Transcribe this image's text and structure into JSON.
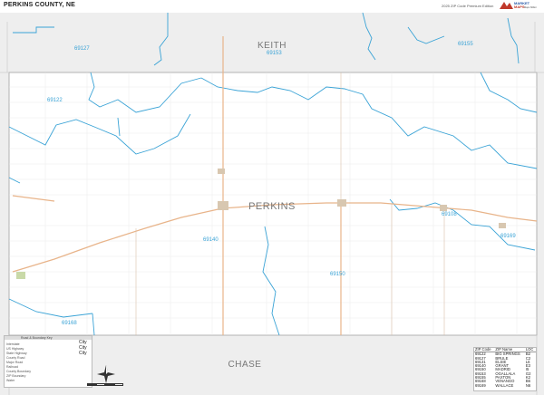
{
  "header": {
    "title": "PERKINS COUNTY, NE",
    "edition": "2025 ZIP Code Premium Edition",
    "brand_line1": "MARKET",
    "brand_line2": "MAPS",
    "brand_line3": "Maps Millions"
  },
  "counties": {
    "main": "PERKINS",
    "north": "KEITH",
    "south": "CHASE"
  },
  "zip_labels": [
    "69127",
    "69153",
    "69155",
    "69122",
    "69108",
    "69169",
    "69140",
    "69150",
    "69168"
  ],
  "legend": {
    "title": "Road & Boundary Key",
    "city_label": "City",
    "city_line2": "City",
    "city_line3": "City",
    "rows": [
      "Interstate",
      "US Highway",
      "State Highway",
      "County Road",
      "Major Road",
      "Railroad",
      "County Boundary",
      "ZIP Boundary",
      "Water"
    ]
  },
  "zip_table": {
    "headers": [
      "ZIP Code",
      "ZIP Name",
      "LOC"
    ],
    "rows": [
      [
        "69122",
        "BIG SPRINGS",
        "B2"
      ],
      [
        "69127",
        "BRULE",
        "C2"
      ],
      [
        "69131",
        "ELSIE",
        "L6"
      ],
      [
        "69140",
        "GRANT",
        "E3"
      ],
      [
        "69150",
        "MADRID",
        "I5"
      ],
      [
        "69153",
        "OGALLALA",
        "G2"
      ],
      [
        "69155",
        "PAXTON",
        "K2"
      ],
      [
        "69168",
        "VENANGO",
        "B6"
      ],
      [
        "69169",
        "WALLACE",
        "N6"
      ]
    ]
  },
  "colors": {
    "county_fill": "#ffffff",
    "outside_fill": "#eeeeee",
    "zip_boundary": "#3aa3d6",
    "road": "#e8b48a",
    "county_boundary": "#b3b3b3",
    "section_grid": "#d6d6d6"
  }
}
